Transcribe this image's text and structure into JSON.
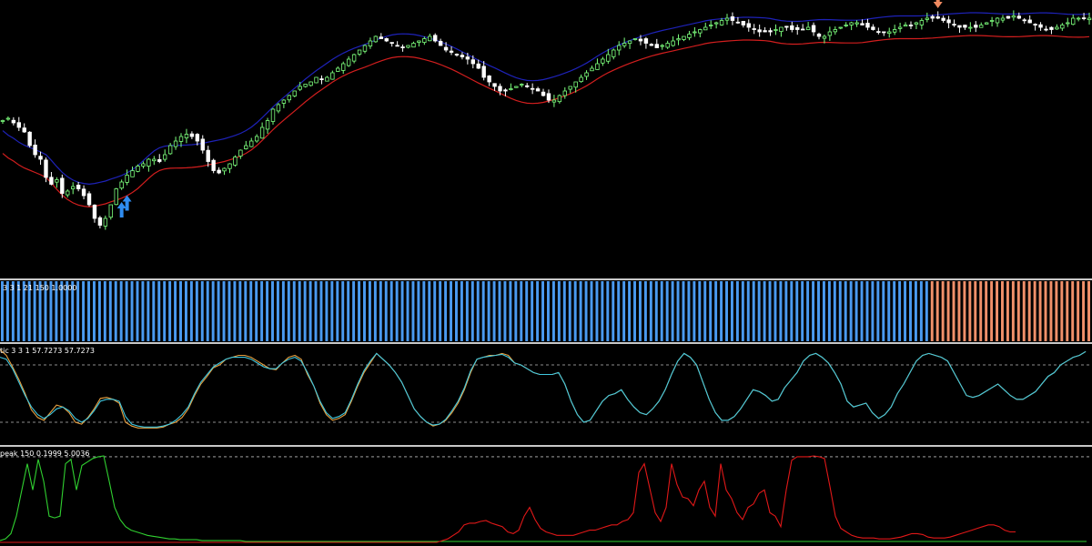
{
  "panes": {
    "histogram_label": "3 3 1 21 150 1.0000",
    "stochastic_label": "tic  3 3 1 57.7273 57.7273",
    "peak_label": "peak  150 0.1999 5.0036"
  },
  "colors": {
    "background": "#000000",
    "bull_candle": "#7dff7d",
    "bear_candle": "#ffffff",
    "upper_band": "#1e22b8",
    "lower_band": "#d21e1e",
    "buy_arrow": "#2f8cf0",
    "sell_arrow": "#f08a60",
    "hist_blue": "#4a9af0",
    "hist_orange": "#f0906a",
    "stoch_main": "#e8a040",
    "stoch_signal": "#40c8e0",
    "peak_green": "#30d030",
    "peak_red": "#e01818"
  },
  "chart_data": [
    {
      "type": "candlestick",
      "x_count": 200,
      "ylim": [
        0,
        100
      ],
      "close": [
        55,
        56,
        54,
        52,
        50,
        44,
        40,
        38,
        30,
        27,
        29,
        23,
        24,
        26,
        25,
        22,
        18,
        12,
        9,
        12,
        18,
        25,
        28,
        31,
        33,
        35,
        36,
        38,
        38,
        37,
        40,
        44,
        46,
        48,
        49,
        48,
        46,
        42,
        37,
        33,
        32,
        34,
        36,
        39,
        42,
        44,
        46,
        48,
        52,
        55,
        60,
        62,
        64,
        66,
        68,
        70,
        71,
        72,
        74,
        73,
        74,
        76,
        78,
        80,
        82,
        84,
        86,
        88,
        90,
        92,
        91,
        90,
        89,
        88,
        87,
        88,
        89,
        90,
        91,
        92,
        90,
        88,
        86,
        85,
        84,
        83,
        82,
        80,
        78,
        74,
        72,
        70,
        68,
        68,
        69,
        70,
        71,
        70,
        69,
        68,
        66,
        64,
        64,
        66,
        68,
        70,
        72,
        74,
        76,
        78,
        80,
        82,
        84,
        86,
        88,
        89,
        90,
        91,
        90,
        89,
        88,
        87,
        88,
        89,
        90,
        91,
        92,
        93,
        94,
        95,
        96,
        97,
        98,
        99,
        100,
        99,
        98,
        97,
        96,
        95,
        94,
        94,
        94,
        95,
        96,
        96,
        95,
        95,
        95,
        96,
        94,
        92,
        92,
        94,
        95,
        96,
        97,
        98,
        98,
        97,
        96,
        95,
        94,
        94,
        94,
        95,
        96,
        97,
        97,
        98,
        99,
        100,
        100,
        100,
        99,
        98,
        97,
        96,
        96,
        96,
        96,
        97,
        98,
        99,
        100,
        100,
        100,
        101,
        100,
        99,
        98,
        97,
        96,
        95,
        95,
        96,
        97,
        98,
        100,
        100,
        100,
        100
      ],
      "up_signals": [
        22,
        23
      ],
      "down_signals": [
        173
      ],
      "hist_blue_bars": 172,
      "hist_orange_bars": 28
    },
    {
      "type": "line",
      "ylim": [
        0,
        100
      ],
      "series": [
        {
          "values": [
            96,
            90,
            78,
            65,
            50,
            33,
            25,
            22,
            30,
            38,
            36,
            30,
            20,
            18,
            25,
            34,
            45,
            46,
            44,
            40,
            20,
            16,
            14,
            14,
            14,
            14,
            15,
            18,
            20,
            25,
            34,
            48,
            60,
            68,
            77,
            80,
            86,
            88,
            90,
            90,
            88,
            84,
            80,
            76,
            75,
            82,
            88,
            90,
            86,
            70,
            58,
            40,
            28,
            22,
            24,
            28,
            42,
            58,
            72,
            82,
            92,
            86,
            80,
            72,
            62,
            48,
            34,
            26,
            20,
            16,
            18,
            22,
            30,
            40,
            54,
            72,
            86,
            88,
            90,
            90,
            92,
            90,
            82,
            80,
            76,
            72,
            70,
            70,
            70,
            72,
            60,
            42,
            28,
            20,
            22,
            32,
            42,
            48,
            50,
            54,
            44,
            36,
            30,
            28,
            34,
            42,
            54,
            70,
            84,
            92,
            88,
            80,
            62,
            44,
            30,
            22,
            22,
            26,
            34,
            44,
            54,
            52,
            48,
            42,
            44,
            56,
            64,
            72,
            84,
            90,
            92,
            88,
            82,
            72,
            60,
            42,
            36,
            38,
            40,
            30,
            24,
            28,
            36,
            50,
            60,
            72,
            84,
            90,
            92,
            90,
            88,
            84,
            72,
            60,
            48,
            46,
            48,
            52,
            56,
            60,
            54,
            48,
            44,
            44,
            48,
            52,
            60,
            68,
            72,
            80,
            84,
            88,
            90,
            94
          ]
        },
        {
          "values": [
            88,
            86,
            76,
            62,
            48,
            36,
            28,
            24,
            28,
            34,
            36,
            32,
            24,
            20,
            24,
            32,
            42,
            44,
            44,
            42,
            26,
            18,
            16,
            15,
            15,
            15,
            16,
            18,
            22,
            28,
            36,
            50,
            62,
            70,
            78,
            82,
            86,
            88,
            88,
            88,
            86,
            82,
            78,
            76,
            76,
            82,
            86,
            88,
            84,
            72,
            58,
            42,
            30,
            24,
            26,
            30,
            44,
            60,
            74,
            84,
            92,
            86,
            80,
            72,
            62,
            48,
            34,
            26,
            20,
            17,
            18,
            23,
            32,
            42,
            56,
            74,
            86,
            88,
            89,
            90,
            91,
            88,
            82,
            80,
            76,
            72,
            70,
            70,
            70,
            72,
            60,
            42,
            28,
            20,
            22,
            32,
            42,
            48,
            50,
            54,
            44,
            36,
            30,
            28,
            34,
            42,
            54,
            70,
            84,
            92,
            88,
            80,
            62,
            44,
            30,
            22,
            22,
            26,
            34,
            44,
            54,
            52,
            48,
            42,
            44,
            56,
            64,
            72,
            84,
            90,
            92,
            88,
            82,
            72,
            60,
            42,
            36,
            38,
            40,
            30,
            24,
            28,
            36,
            50,
            60,
            72,
            84,
            90,
            92,
            90,
            88,
            84,
            72,
            60,
            48,
            46,
            48,
            52,
            56,
            60,
            54,
            48,
            44,
            44,
            48,
            52,
            60,
            68,
            72,
            80,
            84,
            88,
            90,
            94
          ]
        }
      ]
    },
    {
      "type": "line",
      "ylim": [
        0,
        100
      ],
      "series": [
        {
          "values": [
            2,
            4,
            10,
            30,
            60,
            90,
            60,
            95,
            70,
            30,
            28,
            30,
            90,
            95,
            60,
            88,
            92,
            96,
            98,
            99,
            70,
            40,
            26,
            18,
            14,
            12,
            10,
            8,
            7,
            6,
            5,
            4,
            4,
            3,
            3,
            3,
            3,
            2,
            2,
            2,
            2,
            2,
            2,
            2,
            2,
            1,
            1,
            1,
            1,
            1,
            1,
            1,
            1,
            1,
            1,
            1,
            1,
            1,
            1,
            1,
            1,
            1,
            1,
            1,
            1,
            1,
            1,
            1,
            1,
            1,
            1,
            1,
            1,
            1,
            1,
            1,
            1,
            1,
            1,
            1,
            1,
            1,
            1,
            1,
            1,
            1,
            1,
            1,
            1,
            1,
            1,
            1,
            1,
            1,
            1,
            1,
            1,
            1,
            1,
            1,
            1,
            1,
            1,
            1,
            1,
            1,
            1,
            1,
            1,
            1,
            1,
            1,
            1,
            1,
            1,
            1,
            1,
            1,
            1,
            1,
            1,
            1,
            1,
            1,
            1,
            1,
            1,
            1,
            1,
            1,
            1,
            1,
            1,
            1,
            1,
            1,
            1,
            1,
            1,
            1,
            1,
            1,
            1,
            1,
            1,
            1,
            1,
            1,
            1,
            1,
            1,
            1,
            1,
            1,
            1,
            1,
            1,
            1,
            1,
            1,
            1,
            1,
            1,
            1,
            1,
            1,
            1,
            1,
            1,
            1,
            1,
            1,
            1,
            1,
            1,
            1,
            1,
            1,
            1,
            1,
            1,
            1,
            1,
            1,
            1,
            1,
            1,
            1,
            1,
            1,
            1,
            1,
            1,
            1,
            1,
            1,
            1,
            1,
            1,
            1
          ]
        },
        {
          "values": [
            0,
            0,
            0,
            0,
            0,
            0,
            0,
            0,
            0,
            0,
            0,
            0,
            0,
            0,
            0,
            0,
            0,
            0,
            0,
            0,
            0,
            0,
            0,
            0,
            0,
            0,
            0,
            0,
            0,
            0,
            0,
            0,
            0,
            0,
            0,
            0,
            0,
            0,
            0,
            0,
            0,
            0,
            0,
            0,
            0,
            0,
            0,
            0,
            0,
            0,
            0,
            0,
            0,
            0,
            0,
            0,
            0,
            0,
            0,
            0,
            0,
            0,
            0,
            0,
            0,
            0,
            0,
            0,
            0,
            0,
            0,
            0,
            0,
            0,
            0,
            0,
            0,
            0,
            0,
            0,
            0,
            2,
            4,
            8,
            12,
            20,
            22,
            22,
            24,
            25,
            22,
            20,
            18,
            12,
            10,
            14,
            30,
            40,
            26,
            16,
            12,
            10,
            8,
            8,
            8,
            8,
            10,
            12,
            14,
            14,
            16,
            18,
            20,
            20,
            24,
            26,
            34,
            80,
            90,
            62,
            34,
            24,
            40,
            90,
            66,
            52,
            50,
            42,
            60,
            70,
            40,
            30,
            90,
            60,
            50,
            34,
            26,
            40,
            44,
            56,
            60,
            34,
            30,
            18,
            60,
            94,
            98,
            98,
            98,
            99,
            98,
            96,
            64,
            30,
            16,
            12,
            8,
            6,
            5,
            5,
            5,
            4,
            4,
            4,
            5,
            6,
            8,
            10,
            10,
            9,
            6,
            5,
            5,
            5,
            6,
            8,
            10,
            12,
            14,
            16,
            18,
            20,
            20,
            18,
            14,
            12,
            12
          ]
        }
      ]
    }
  ]
}
